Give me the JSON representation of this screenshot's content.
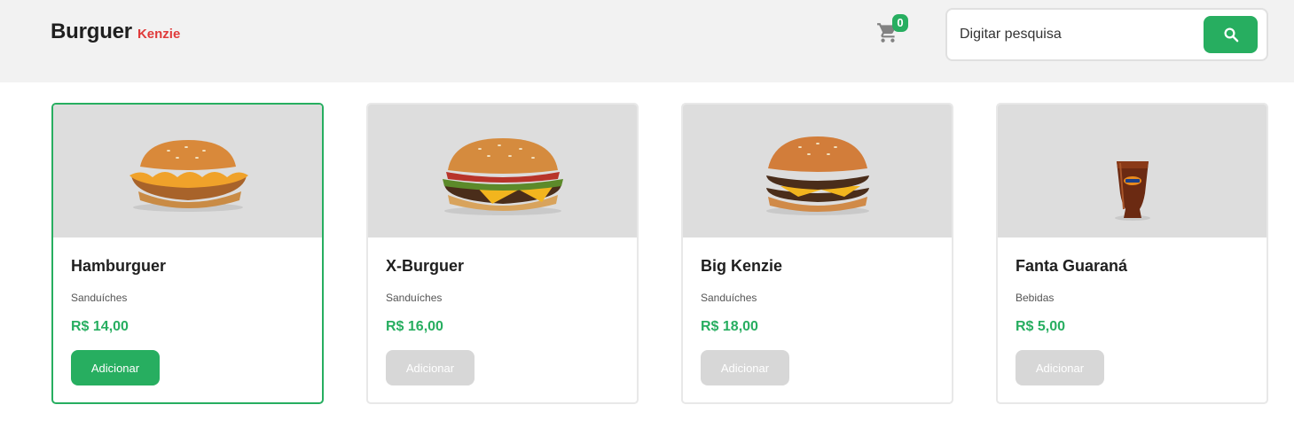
{
  "header": {
    "brand_main": "Burguer",
    "brand_sub": "Kenzie",
    "cart_count": "0",
    "cart_icon": "shopping-cart-icon",
    "search_placeholder": "Digitar pesquisa",
    "search_icon": "search-icon"
  },
  "colors": {
    "accent": "#27ae60",
    "brand_red": "#e03a3a",
    "header_bg": "#f2f2f2",
    "image_bg": "#dddddd",
    "disabled_button": "#bdbdbd"
  },
  "products": [
    {
      "name": "Hamburguer",
      "category": "Sanduíches",
      "price": "R$ 14,00",
      "button": "Adicionar",
      "image": "hamburguer-image"
    },
    {
      "name": "X-Burguer",
      "category": "Sanduíches",
      "price": "R$ 16,00",
      "button": "Adicionar",
      "image": "x-burguer-image"
    },
    {
      "name": "Big Kenzie",
      "category": "Sanduíches",
      "price": "R$ 18,00",
      "button": "Adicionar",
      "image": "big-kenzie-image"
    },
    {
      "name": "Fanta Guaraná",
      "category": "Bebidas",
      "price": "R$ 5,00",
      "button": "Adicionar",
      "image": "fanta-guarana-image"
    }
  ]
}
